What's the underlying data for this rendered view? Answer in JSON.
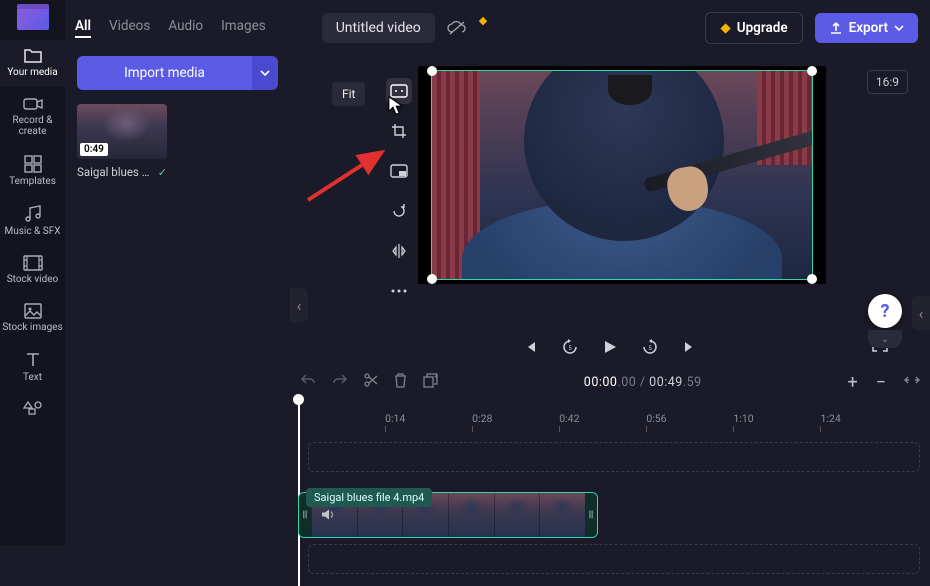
{
  "rail": {
    "items": [
      {
        "label": "Your media"
      },
      {
        "label": "Record & create"
      },
      {
        "label": "Templates"
      },
      {
        "label": "Music & SFX"
      },
      {
        "label": "Stock video"
      },
      {
        "label": "Stock images"
      },
      {
        "label": "Text"
      }
    ]
  },
  "tabs": {
    "all": "All",
    "videos": "Videos",
    "audio": "Audio",
    "images": "Images"
  },
  "import_label": "Import media",
  "media": {
    "thumb_duration": "0:49",
    "thumb_label": "Saigal blues f..."
  },
  "header": {
    "title": "Untitled video",
    "upgrade": "Upgrade",
    "export": "Export"
  },
  "stage": {
    "aspect": "16:9",
    "fit_tooltip": "Fit"
  },
  "timeline": {
    "current": "00:00",
    "current_frac": ".00",
    "total": "00:49",
    "total_frac": ".59",
    "ticks": [
      "0:14",
      "0:28",
      "0:42",
      "0:56",
      "1:10",
      "1:24"
    ],
    "clip_label": "Saigal blues file 4.mp4"
  },
  "help": "?"
}
